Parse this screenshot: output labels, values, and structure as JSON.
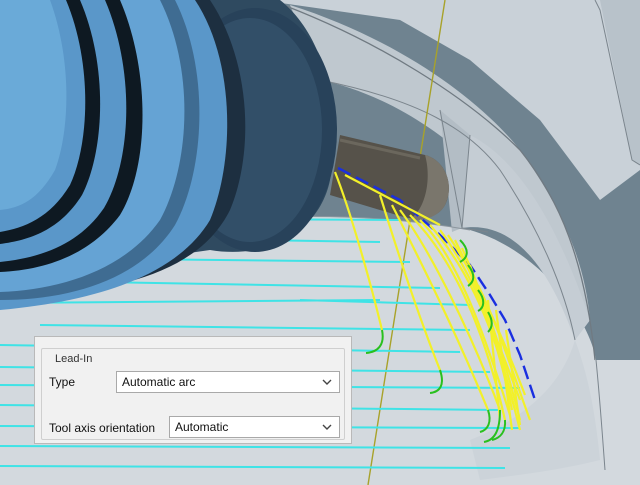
{
  "panel": {
    "group_title": "Lead-In",
    "type_label": "Type",
    "type_value": "Automatic arc",
    "tool_axis_label": "Tool axis orientation",
    "tool_axis_value": "Automatic"
  },
  "icons": {
    "dropdown_chevron": "chevron-down-icon"
  },
  "colors": {
    "toolpath_passes": "#3fe3e6",
    "lead_in_moves": "#f2f02a",
    "lead_in_arcs": "#29c01e",
    "link_moves": "#1a2fe0",
    "tool_body": "#5a97c9"
  }
}
